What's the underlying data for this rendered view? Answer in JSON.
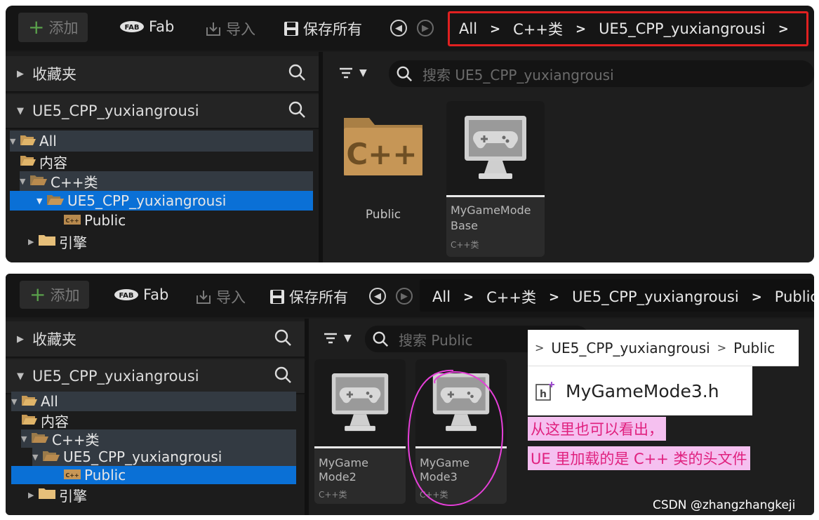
{
  "toolbar": {
    "add_label": "添加",
    "fab_label": "Fab",
    "import_label": "导入",
    "save_all_label": "保存所有"
  },
  "breadcrumbs_top": [
    "All",
    "C++类",
    "UE5_CPP_yuxiangrousi"
  ],
  "breadcrumbs_bottom": [
    "All",
    "C++类",
    "UE5_CPP_yuxiangrousi",
    "Public"
  ],
  "sidebar": {
    "favorites_label": "收藏夹",
    "project_label": "UE5_CPP_yuxiangrousi",
    "tree": {
      "all": "All",
      "content": "内容",
      "cpp": "C++类",
      "project": "UE5_CPP_yuxiangrousi",
      "public": "Public",
      "engine": "引擎"
    }
  },
  "search_top": {
    "placeholder": "搜索 UE5_CPP_yuxiangrousi"
  },
  "search_bottom": {
    "placeholder": "搜索 Public"
  },
  "assets_top": {
    "folder": {
      "label": "Public"
    },
    "gamemode": {
      "name_line1": "MyGameMode",
      "name_line2": "Base",
      "type": "C++类"
    }
  },
  "assets_bottom": [
    {
      "name_line1": "MyGame",
      "name_line2": "Mode2",
      "type": "C++类"
    },
    {
      "name_line1": "MyGame",
      "name_line2": "Mode3",
      "type": "C++类"
    }
  ],
  "popup": {
    "crumb_1": "UE5_CPP_yuxiangrousi",
    "crumb_2": "Public",
    "file_name": "MyGameMode3.h"
  },
  "annotation": {
    "line1": "从这里也可以看出，",
    "line2": "UE 里加载的是 C++ 类的头文件"
  },
  "watermark": "CSDN @zhangzhangkeji",
  "colors": {
    "accent_blue": "#0a70d6",
    "highlight_red": "#e02020",
    "annotation_pink": "#e0207e",
    "folder_brown": "#b88a4e",
    "add_green": "#5aa14b"
  }
}
